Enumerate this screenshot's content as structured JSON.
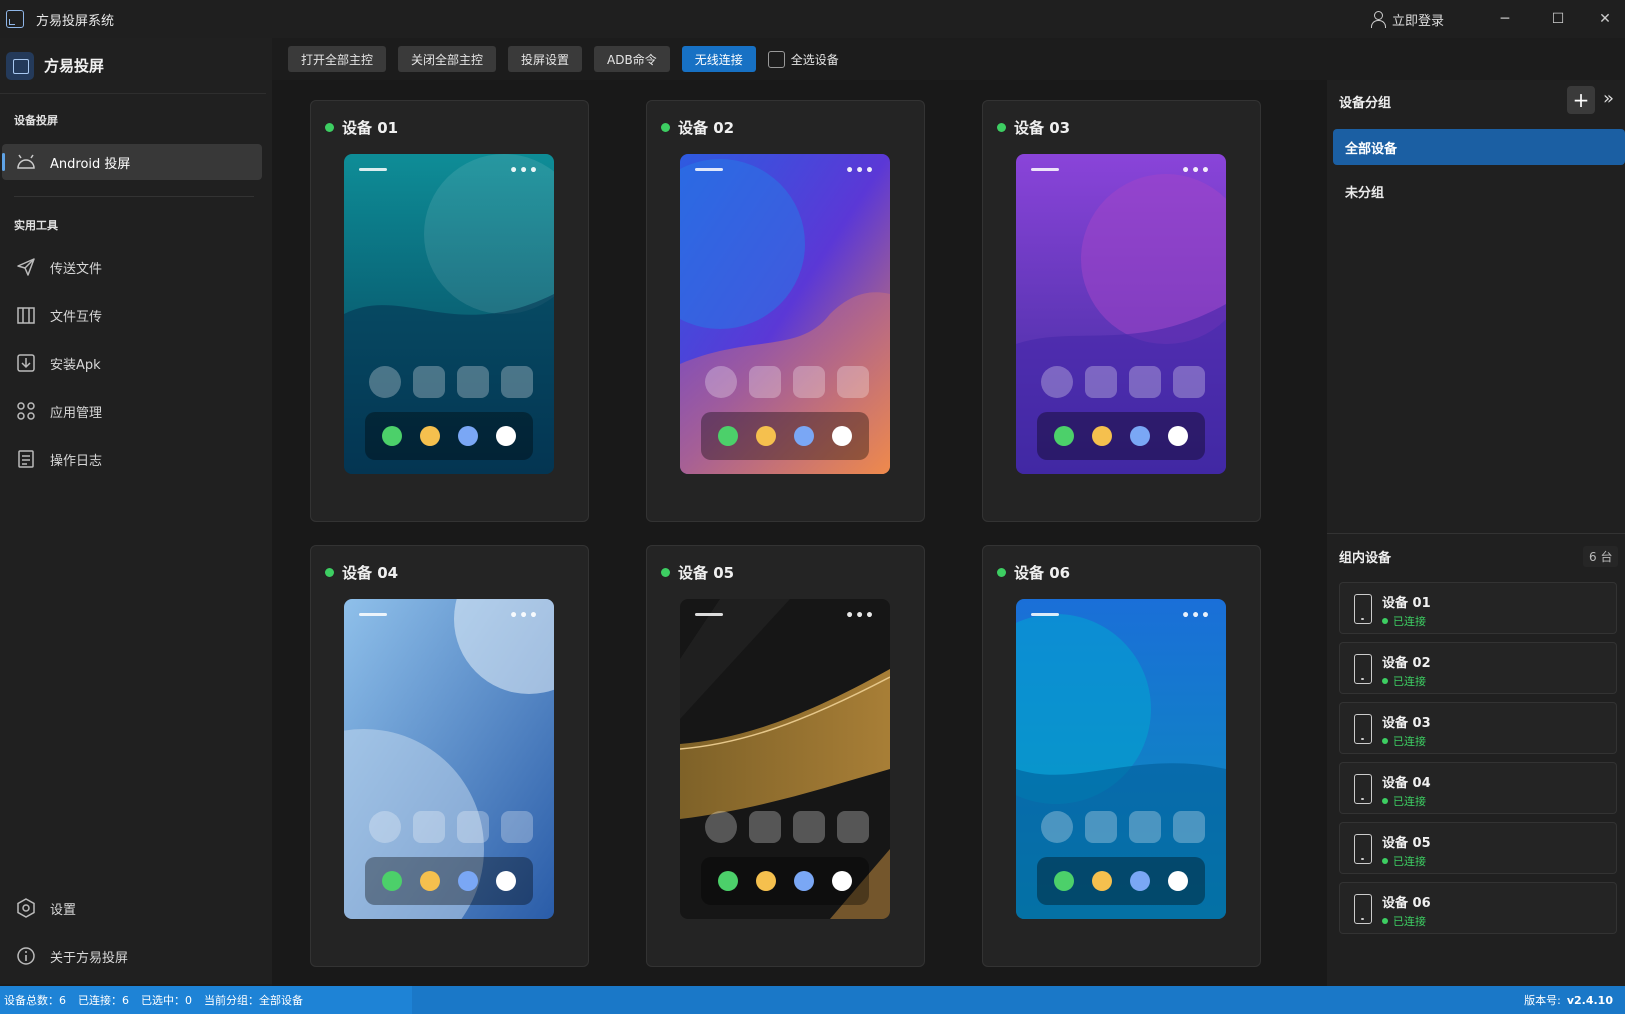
{
  "window": {
    "title": "方易投屏系统",
    "login_label": "立即登录",
    "minimize": "─",
    "maximize": "☐",
    "close": "✕"
  },
  "sidebar": {
    "brand": "方易投屏",
    "section1": "设备投屏",
    "android": "Android 投屏",
    "section2": "实用工具",
    "tools": [
      "传送文件",
      "文件互传",
      "安装Apk",
      "应用管理",
      "操作日志"
    ],
    "settings": "设置",
    "about": "关于方易投屏"
  },
  "toolbar": {
    "open_all": "打开全部主控",
    "close_all": "关闭全部主控",
    "cast_settings": "投屏设置",
    "adb": "ADB命令",
    "wireless": "无线连接",
    "select_all": "全选设备"
  },
  "devices": [
    {
      "name": "设备 01",
      "theme": "teal"
    },
    {
      "name": "设备 02",
      "theme": "blue-orange"
    },
    {
      "name": "设备 03",
      "theme": "purple"
    },
    {
      "name": "设备 04",
      "theme": "lightblue"
    },
    {
      "name": "设备 05",
      "theme": "black-gold"
    },
    {
      "name": "设备 06",
      "theme": "ocean"
    }
  ],
  "right_panel": {
    "group_title": "设备分组",
    "add": "+",
    "collapse": "»",
    "groups": [
      "全部设备",
      "未分组"
    ],
    "members_title": "组内设备",
    "count": "6 台",
    "members": [
      {
        "name": "设备 01",
        "status": "已连接"
      },
      {
        "name": "设备 02",
        "status": "已连接"
      },
      {
        "name": "设备 03",
        "status": "已连接"
      },
      {
        "name": "设备 04",
        "status": "已连接"
      },
      {
        "name": "设备 05",
        "status": "已连接"
      },
      {
        "name": "设备 06",
        "status": "已连接"
      }
    ]
  },
  "statusbar": {
    "total": "设备总数：6",
    "connected": "已连接：6",
    "selected": "已选中：0",
    "group": "当前分组：全部设备",
    "version_label": "版本号:",
    "version": "v2.4.10"
  },
  "colors": {
    "accent": "#1771c4",
    "online": "#3dce62",
    "dock": [
      "#4cd06a",
      "#f5c04e",
      "#7aa7f5",
      "#ffffff"
    ]
  }
}
